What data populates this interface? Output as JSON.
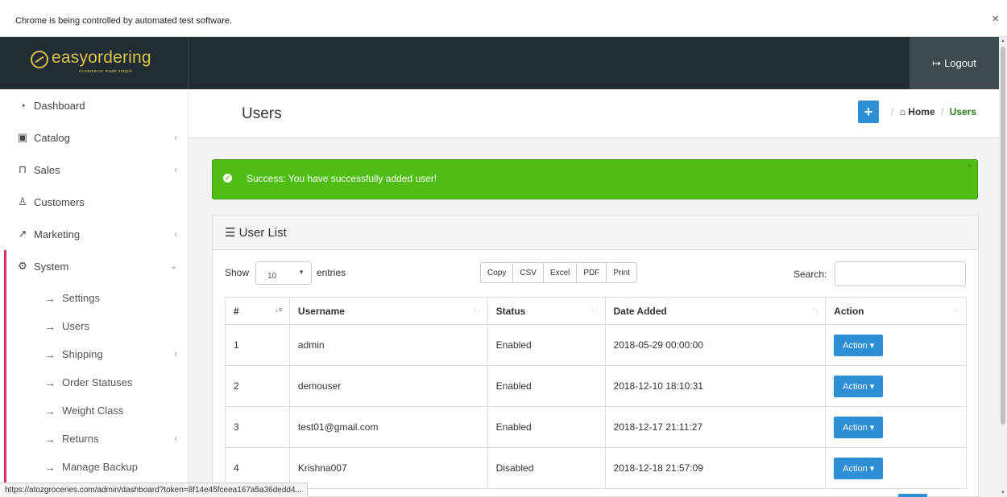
{
  "browser": {
    "infobar_text": "Chrome is being controlled by automated test software.",
    "close_glyph": "×",
    "status_url": "https://atozgroceries.com/admin/dashboard?token=8f14e45fceea167a5a36dedd4..."
  },
  "header": {
    "logo_text": "easyordering",
    "logo_tagline": "ecommerce made simple",
    "logout_icon": "↦",
    "logout_label": "Logout"
  },
  "sidebar": {
    "items": [
      {
        "label": "Dashboard",
        "icon": "dashboard-icon",
        "glyph": "◔",
        "chevron": ""
      },
      {
        "label": "Catalog",
        "icon": "tag-icon",
        "glyph": "▣",
        "chevron": "‹"
      },
      {
        "label": "Sales",
        "icon": "cart-icon",
        "glyph": "⊓",
        "chevron": "‹"
      },
      {
        "label": "Customers",
        "icon": "user-icon",
        "glyph": "♙",
        "chevron": ""
      },
      {
        "label": "Marketing",
        "icon": "share-icon",
        "glyph": "↗",
        "chevron": "‹"
      },
      {
        "label": "System",
        "icon": "gear-icon",
        "glyph": "⚙",
        "chevron": "⌄"
      }
    ],
    "system_subitems": [
      {
        "label": "Settings",
        "chevron": ""
      },
      {
        "label": "Users",
        "chevron": ""
      },
      {
        "label": "Shipping",
        "chevron": "‹"
      },
      {
        "label": "Order Statuses",
        "chevron": ""
      },
      {
        "label": "Weight Class",
        "chevron": ""
      },
      {
        "label": "Returns",
        "chevron": "‹"
      },
      {
        "label": "Manage Backup",
        "chevron": ""
      }
    ],
    "sub_arrow": "→"
  },
  "page": {
    "title": "Users",
    "add_glyph": "+",
    "breadcrumb_sep": "/",
    "breadcrumb_home_glyph": "⌂",
    "breadcrumb_home": "Home",
    "breadcrumb_current": "Users"
  },
  "alert": {
    "check_glyph": "✓",
    "message": "Success: You have successfully added user!",
    "close_glyph": "×"
  },
  "panel": {
    "title_glyph": "☰",
    "title": "User List",
    "show_label": "Show",
    "entries_value": "10",
    "caret_glyph": "▼",
    "entries_label": "entries",
    "export_buttons": [
      "Copy",
      "CSV",
      "Excel",
      "PDF",
      "Print"
    ],
    "search_label": "Search:",
    "search_value": ""
  },
  "table": {
    "headers": [
      "#",
      "Username",
      "Status",
      "Date Added",
      "Action"
    ],
    "sort_active_glyph": "↓≡",
    "sort_glyph": "↑↓",
    "action_label": "Action ▾",
    "rows": [
      {
        "id": "1",
        "username": "admin",
        "status": "Enabled",
        "date": "2018-05-29 00:00:00"
      },
      {
        "id": "2",
        "username": "demouser",
        "status": "Enabled",
        "date": "2018-12-10 18:10:31"
      },
      {
        "id": "3",
        "username": "test01@gmail.com",
        "status": "Enabled",
        "date": "2018-12-17 21:11:27"
      },
      {
        "id": "4",
        "username": "Krishna007",
        "status": "Disabled",
        "date": "2018-12-18 21:57:09"
      }
    ]
  },
  "scrollbar": {
    "up_glyph": "▲",
    "down_glyph": "▼"
  },
  "colors": {
    "topbar": "#212d33",
    "logo": "#d8c34b",
    "primary": "#2f8fd6",
    "success": "#4fbd13",
    "active_accent": "#d9325a"
  }
}
